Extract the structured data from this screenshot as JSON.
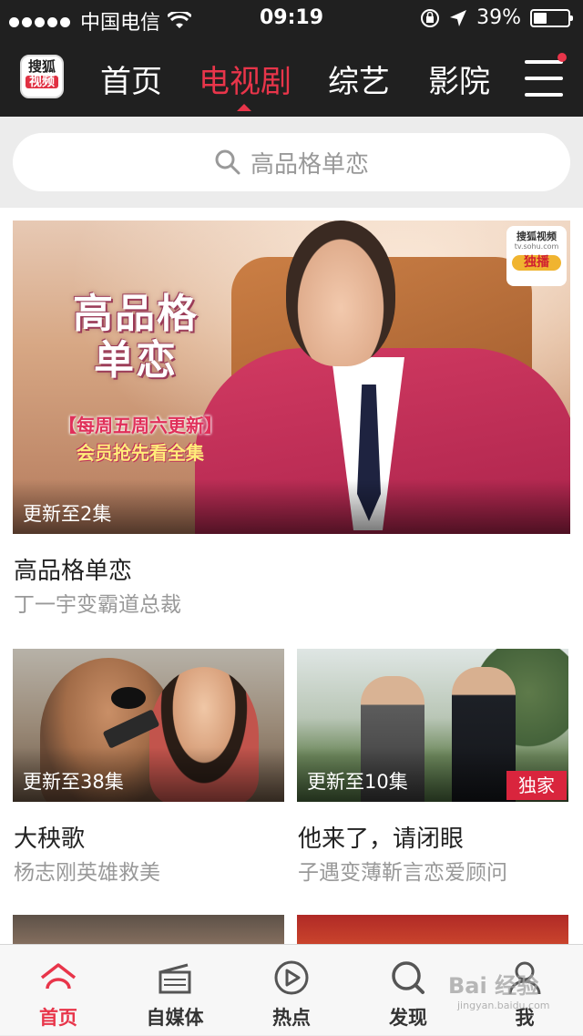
{
  "status_bar": {
    "carrier": "中国电信",
    "time": "09:19",
    "battery": "39%",
    "battery_level": 0.39,
    "icons": [
      "signal-dots-icon",
      "wifi-icon",
      "rotation-lock-icon",
      "location-arrow-icon",
      "battery-icon"
    ]
  },
  "header": {
    "logo_line1": "搜狐",
    "logo_line2": "视频",
    "tabs": [
      {
        "label": "首页",
        "active": false
      },
      {
        "label": "电视剧",
        "active": true
      },
      {
        "label": "综艺",
        "active": false
      },
      {
        "label": "影院",
        "active": false
      }
    ],
    "menu_icon": "hamburger-menu-icon",
    "accent_color": "#e8354a"
  },
  "search": {
    "placeholder": "高品格单恋"
  },
  "hero": {
    "episode": "更新至2集",
    "title": "高品格单恋",
    "subtitle": "丁一宇变霸道总裁",
    "art_title_line1": "高品格",
    "art_title_line2": "单恋",
    "promo_line1": "【每周五周六更新】",
    "promo_line2": "会员抢先看全集",
    "badge_line1": "搜狐视频",
    "badge_line2": "tv.sohu.com",
    "badge_line3": "独播"
  },
  "cards": [
    {
      "episode": "更新至38集",
      "title": "大秧歌",
      "subtitle": "杨志刚英雄救美",
      "exclusive": ""
    },
    {
      "episode": "更新至10集",
      "title": "他来了，请闭眼",
      "subtitle": "子遇变薄靳言恋爱顾问",
      "exclusive": "独家"
    }
  ],
  "tabbar": {
    "items": [
      {
        "label": "首页",
        "icon": "home-roof-icon",
        "active": true
      },
      {
        "label": "自媒体",
        "icon": "clapperboard-icon",
        "active": false
      },
      {
        "label": "热点",
        "icon": "play-circle-icon",
        "active": false
      },
      {
        "label": "发现",
        "icon": "search-icon",
        "active": false
      },
      {
        "label": "我",
        "icon": "person-icon",
        "active": false
      }
    ]
  },
  "watermark": {
    "main": "Bai 经验",
    "sub": "jingyan.baidu.com"
  }
}
